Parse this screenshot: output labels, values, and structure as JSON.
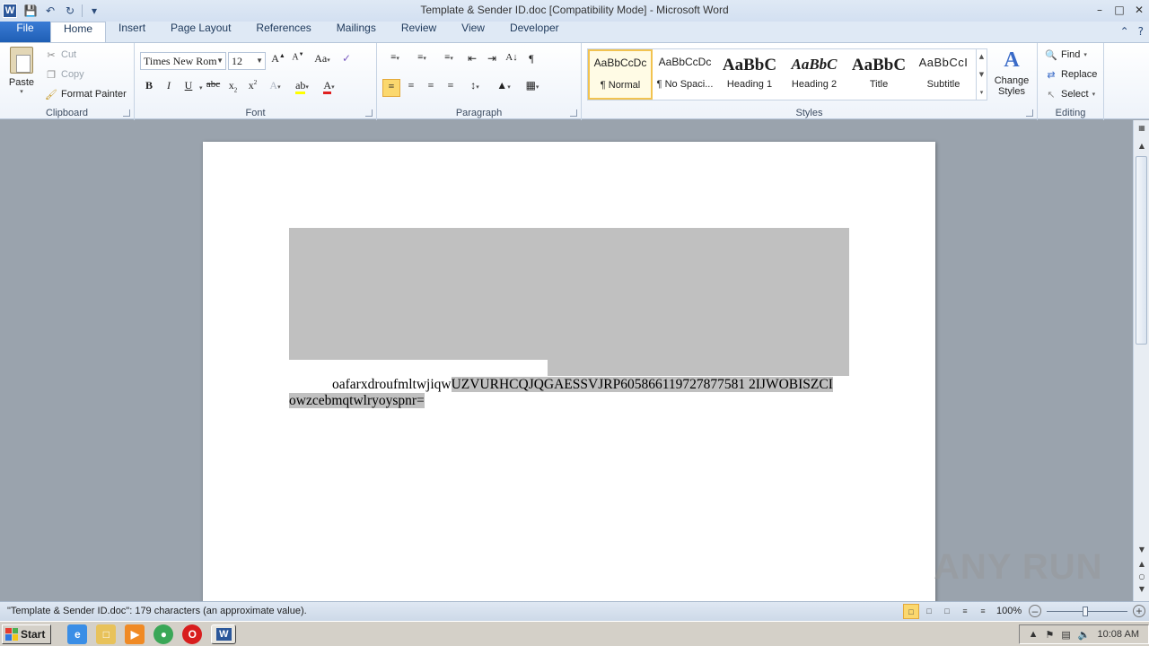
{
  "window": {
    "title": "Template & Sender ID.doc [Compatibility Mode]  -  Microsoft Word",
    "app_icon_letter": "W"
  },
  "tabs": [
    "File",
    "Home",
    "Insert",
    "Page Layout",
    "References",
    "Mailings",
    "Review",
    "View",
    "Developer"
  ],
  "active_tab": "Home",
  "clipboard": {
    "paste_label": "Paste",
    "cut_label": "Cut",
    "copy_label": "Copy",
    "format_painter_label": "Format Painter",
    "group_label": "Clipboard"
  },
  "font": {
    "family": "Times New Rom",
    "size": "12",
    "group_label": "Font"
  },
  "paragraph": {
    "group_label": "Paragraph"
  },
  "styles": {
    "group_label": "Styles",
    "items": [
      {
        "preview": "AaBbCcDc",
        "name": "¶ Normal"
      },
      {
        "preview": "AaBbCcDc",
        "name": "¶ No Spaci..."
      },
      {
        "preview": "AaBbC",
        "name": "Heading 1"
      },
      {
        "preview": "AaBbC",
        "name": "Heading 2"
      },
      {
        "preview": "AaBbC",
        "name": "Title"
      },
      {
        "preview": "AaBbCcI",
        "name": "Subtitle"
      }
    ],
    "change_styles_label": "Change Styles"
  },
  "editing": {
    "group_label": "Editing",
    "find_label": "Find",
    "replace_label": "Replace",
    "select_label": "Select"
  },
  "document": {
    "line1_plain": "oafarxdroufmltwjiqw",
    "line1_highlight": "UZVURHCQJQGAESSVJRP605866119727877581 2IJWOBISZCI",
    "line2_highlight": "owzcebmqtwlryoyspnr="
  },
  "status": {
    "text": "\"Template & Sender ID.doc\": 179 characters (an approximate value).",
    "zoom": "100%"
  },
  "taskbar": {
    "start_label": "Start",
    "clock": "10:08 AM"
  },
  "watermark": "ANY RUN"
}
